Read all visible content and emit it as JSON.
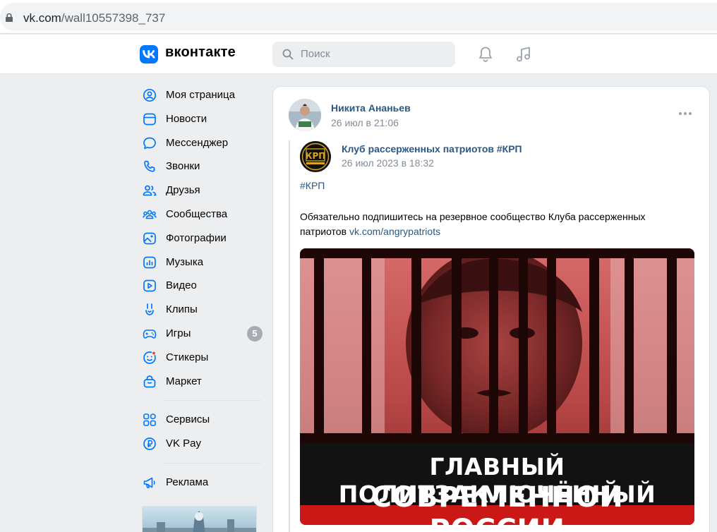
{
  "browser": {
    "url_domain": "vk.com",
    "url_path": "/wall10557398_737"
  },
  "header": {
    "brand": "вконтакте",
    "search_placeholder": "Поиск"
  },
  "sidebar": {
    "items": [
      {
        "label": "Моя страница",
        "icon": "user-circle-icon"
      },
      {
        "label": "Новости",
        "icon": "news-icon"
      },
      {
        "label": "Мессенджер",
        "icon": "message-icon"
      },
      {
        "label": "Звонки",
        "icon": "phone-icon"
      },
      {
        "label": "Друзья",
        "icon": "friends-icon"
      },
      {
        "label": "Сообщества",
        "icon": "communities-icon"
      },
      {
        "label": "Фотографии",
        "icon": "photo-icon"
      },
      {
        "label": "Музыка",
        "icon": "music-icon"
      },
      {
        "label": "Видео",
        "icon": "video-icon"
      },
      {
        "label": "Клипы",
        "icon": "clips-icon"
      },
      {
        "label": "Игры",
        "icon": "gamepad-icon",
        "badge": "5"
      },
      {
        "label": "Стикеры",
        "icon": "sticker-icon"
      },
      {
        "label": "Маркет",
        "icon": "market-bag-icon"
      }
    ],
    "services": [
      {
        "label": "Сервисы",
        "icon": "services-grid-icon"
      },
      {
        "label": "VK Pay",
        "icon": "vkpay-icon"
      }
    ],
    "ads": [
      {
        "label": "Реклама",
        "icon": "megaphone-icon"
      }
    ]
  },
  "post": {
    "author": "Никита Ананьев",
    "date": "26 июл в 21:06",
    "repost": {
      "club_name": "Клуб рассерженных патриотов #КРП",
      "club_logo_text": "КРП",
      "date": "26 июл 2023 в 18:32",
      "hashtag": "#КРП",
      "text": "Обязательно подпишитесь на резервное сообщество Клуба рассерженных патриотов",
      "link": "vk.com/angrypatriots",
      "image_caption_line1": "ГЛАВНЫЙ ПОЛИТЗАКЛЮЧЁННЫЙ",
      "image_caption_line2": "СОВРЕМЕННОЙ РОССИИ"
    }
  },
  "colors": {
    "vk_blue": "#0077ff",
    "link": "#2a5885",
    "muted": "#818c99",
    "background": "#edeef0",
    "badge": "#a7acb3"
  }
}
